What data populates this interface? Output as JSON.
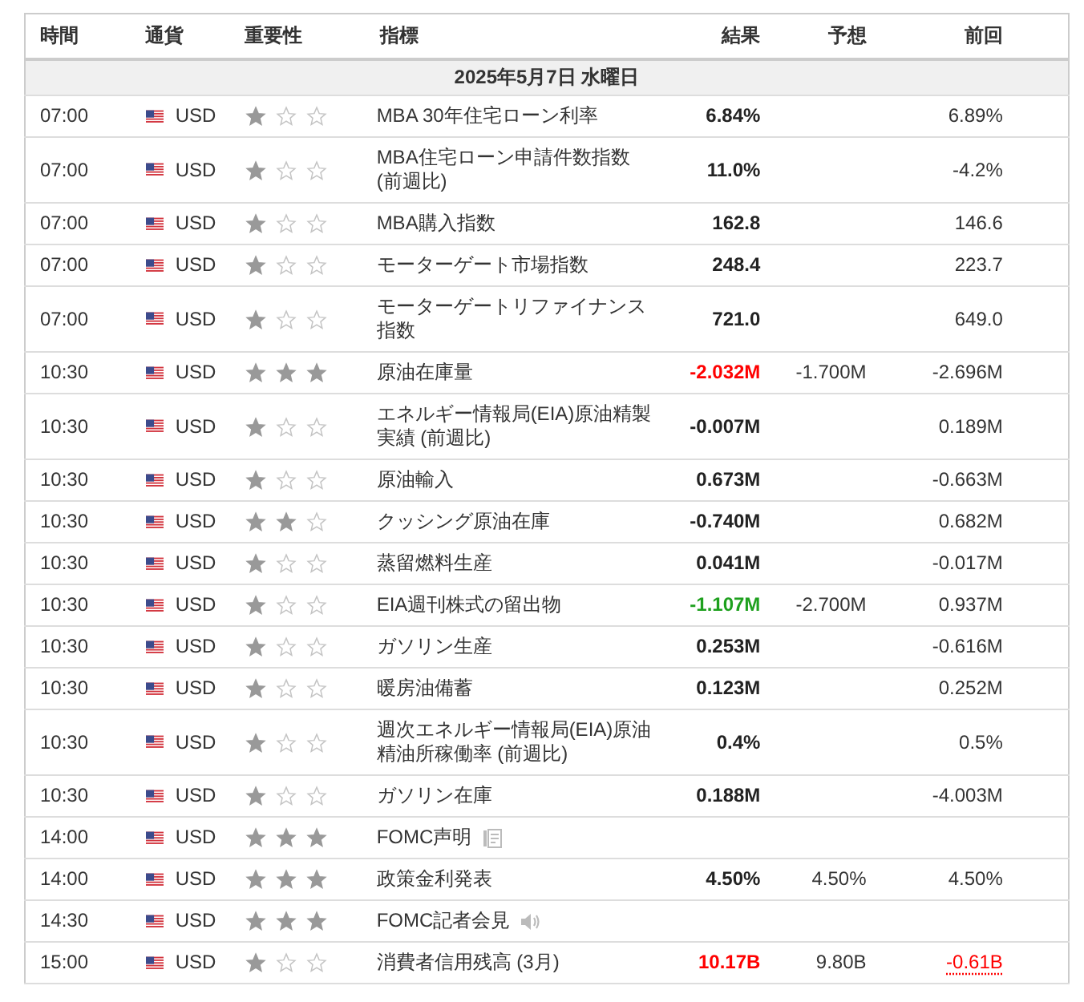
{
  "columns": [
    "時間",
    "通貨",
    "重要性",
    "指標",
    "結果",
    "予想",
    "前回"
  ],
  "date": "2025年5月7日 水曜日",
  "rows": [
    {
      "time": "07:00",
      "currency": "USD",
      "stars": 1,
      "indicator": "MBA 30年住宅ローン利率",
      "actual": {
        "text": "6.84%"
      },
      "previous": "6.89%"
    },
    {
      "time": "07:00",
      "currency": "USD",
      "stars": 1,
      "indicator": "MBA住宅ローン申請件数指数 (前週比)",
      "actual": {
        "text": "11.0%"
      },
      "previous": "-4.2%"
    },
    {
      "time": "07:00",
      "currency": "USD",
      "stars": 1,
      "indicator": "MBA購入指数",
      "actual": {
        "text": "162.8"
      },
      "previous": "146.6"
    },
    {
      "time": "07:00",
      "currency": "USD",
      "stars": 1,
      "indicator": "モーターゲート市場指数",
      "actual": {
        "text": "248.4"
      },
      "previous": "223.7"
    },
    {
      "time": "07:00",
      "currency": "USD",
      "stars": 1,
      "indicator": "モーターゲートリファイナンス指数",
      "actual": {
        "text": "721.0"
      },
      "previous": "649.0"
    },
    {
      "time": "10:30",
      "currency": "USD",
      "stars": 3,
      "indicator": "原油在庫量",
      "actual": {
        "text": "-2.032M",
        "color": "#ff0000"
      },
      "forecast": "-1.700M",
      "previous": "-2.696M"
    },
    {
      "time": "10:30",
      "currency": "USD",
      "stars": 1,
      "indicator": "エネルギー情報局(EIA)原油精製実績 (前週比)",
      "actual": {
        "text": "-0.007M"
      },
      "previous": "0.189M"
    },
    {
      "time": "10:30",
      "currency": "USD",
      "stars": 1,
      "indicator": "原油輸入",
      "actual": {
        "text": "0.673M"
      },
      "previous": "-0.663M"
    },
    {
      "time": "10:30",
      "currency": "USD",
      "stars": 2,
      "indicator": "クッシング原油在庫",
      "actual": {
        "text": "-0.740M"
      },
      "previous": "0.682M"
    },
    {
      "time": "10:30",
      "currency": "USD",
      "stars": 1,
      "indicator": "蒸留燃料生産",
      "actual": {
        "text": "0.041M"
      },
      "previous": "-0.017M"
    },
    {
      "time": "10:30",
      "currency": "USD",
      "stars": 1,
      "indicator": "EIA週刊株式の留出物",
      "actual": {
        "text": "-1.107M",
        "color": "#1ea01e"
      },
      "forecast": "-2.700M",
      "previous": "0.937M"
    },
    {
      "time": "10:30",
      "currency": "USD",
      "stars": 1,
      "indicator": "ガソリン生産",
      "actual": {
        "text": "0.253M"
      },
      "previous": "-0.616M"
    },
    {
      "time": "10:30",
      "currency": "USD",
      "stars": 1,
      "indicator": "暖房油備蓄",
      "actual": {
        "text": "0.123M"
      },
      "previous": "0.252M"
    },
    {
      "time": "10:30",
      "currency": "USD",
      "stars": 1,
      "indicator": "週次エネルギー情報局(EIA)原油精油所稼働率 (前週比)",
      "actual": {
        "text": "0.4%"
      },
      "previous": "0.5%"
    },
    {
      "time": "10:30",
      "currency": "USD",
      "stars": 1,
      "indicator": "ガソリン在庫",
      "actual": {
        "text": "0.188M"
      },
      "previous": "-4.003M"
    },
    {
      "time": "14:00",
      "currency": "USD",
      "stars": 3,
      "indicator": "FOMC声明",
      "kind": "document"
    },
    {
      "time": "14:00",
      "currency": "USD",
      "stars": 3,
      "indicator": "政策金利発表",
      "actual": {
        "text": "4.50%"
      },
      "forecast": "4.50%",
      "previous": "4.50%"
    },
    {
      "time": "14:30",
      "currency": "USD",
      "stars": 3,
      "indicator": "FOMC記者会見",
      "kind": "speaker"
    },
    {
      "time": "15:00",
      "currency": "USD",
      "stars": 1,
      "indicator": "消費者信用残高 (3月)",
      "actual": {
        "text": "10.17B",
        "color": "#ff0000"
      },
      "forecast": "9.80B",
      "previous": "-0.61B",
      "previous_revised": true
    }
  ]
}
